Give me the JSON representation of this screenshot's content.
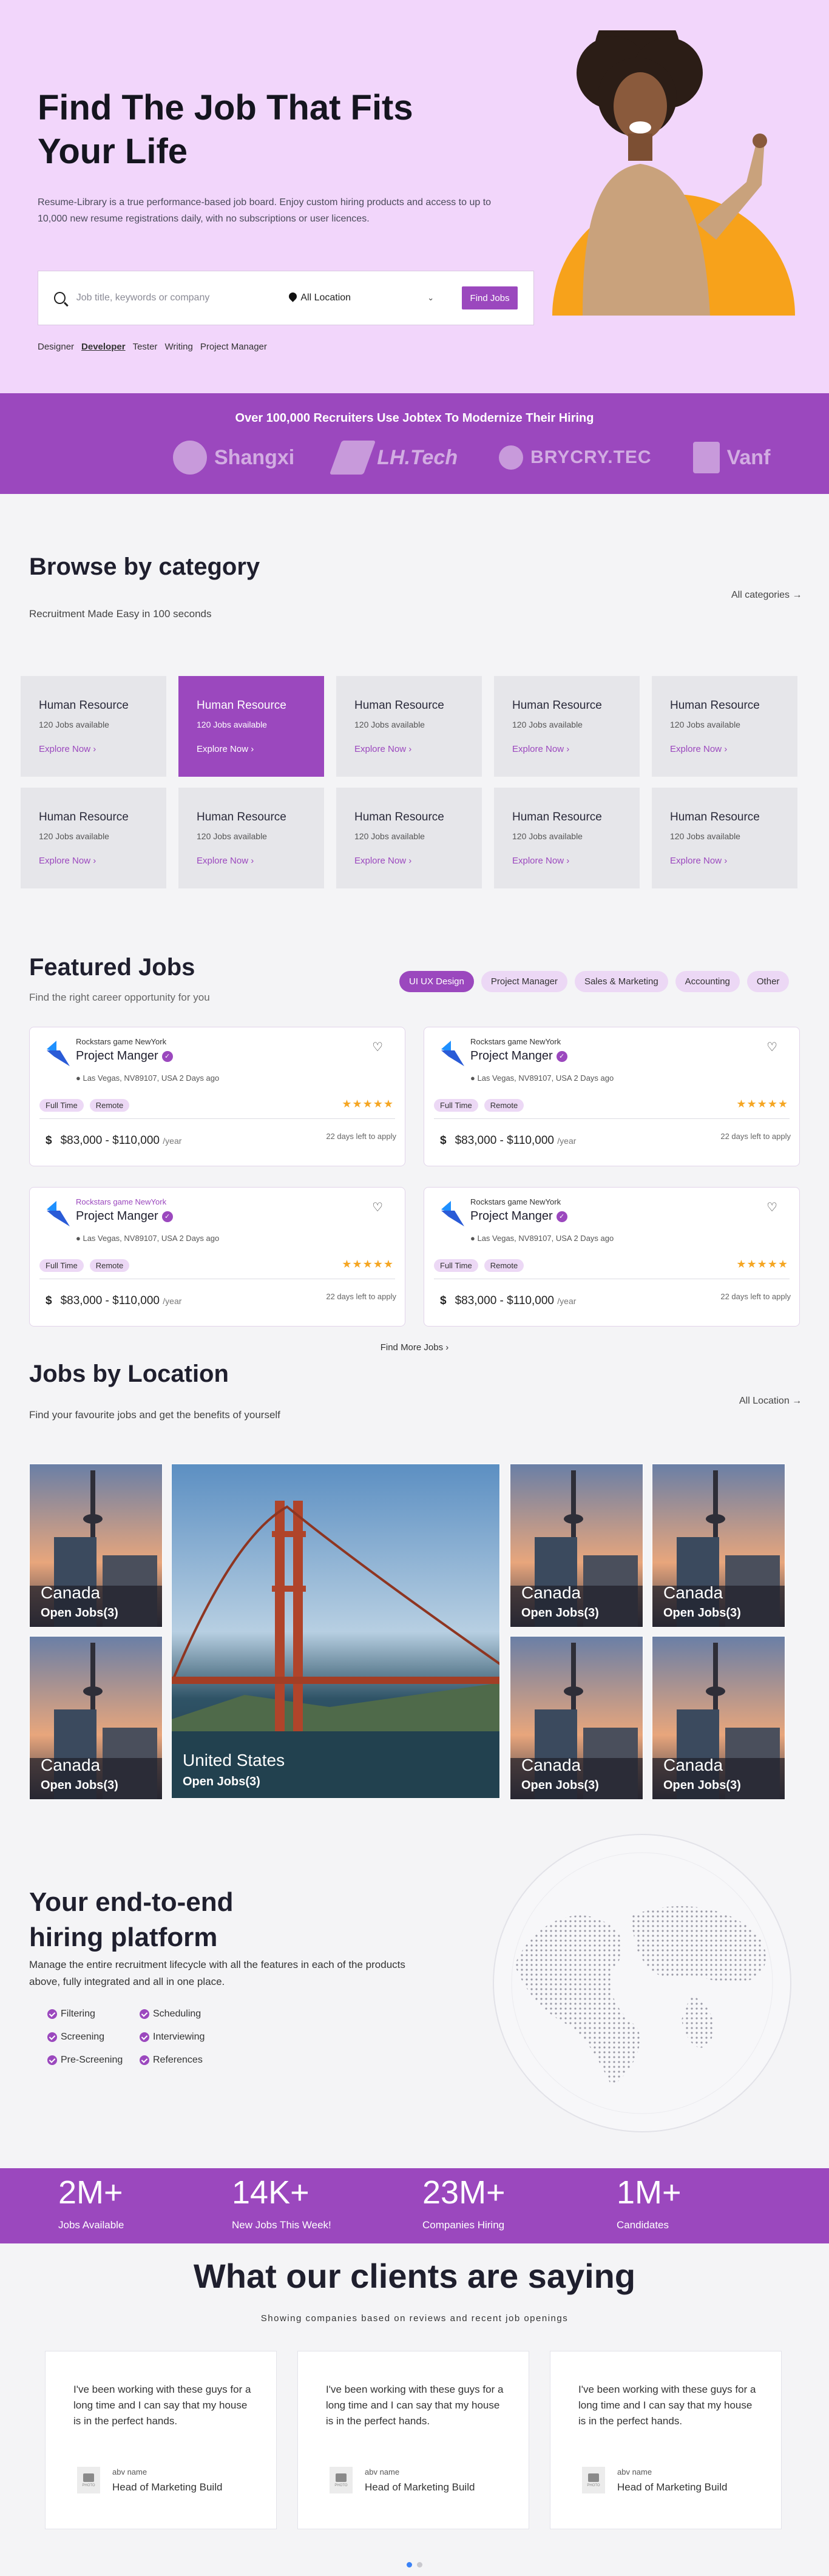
{
  "hero": {
    "title_line1": "Find The Job That Fits",
    "title_line2": "Your Life",
    "lead": "Resume-Library is a true performance-based job board. Enjoy custom hiring products and access to up to 10,000 new resume registrations daily, with no subscriptions or user licences.",
    "search_placeholder": "Job title, keywords or company",
    "location_value": "All Location",
    "find_button": "Find Jobs",
    "tags": [
      "Designer",
      "Developer",
      "Tester",
      "Writing",
      "Project Manager"
    ],
    "active_tag": "Developer"
  },
  "recruiters": {
    "heading": "Over 100,000 Recruiters Use Jobtex To Modernize Their Hiring",
    "logos": [
      "Shangxi",
      "LH.Tech",
      "BRYCRY.TEC",
      "Vanf"
    ]
  },
  "browse": {
    "title": "Browse by category",
    "subtitle": "Recruitment Made Easy in 100 seconds",
    "see_all": "All categories",
    "categories": [
      {
        "title": "Human Resource",
        "count": "120 Jobs available",
        "cta": "Explore Now"
      },
      {
        "title": "Human Resource",
        "count": "120 Jobs available",
        "cta": "Explore Now"
      },
      {
        "title": "Human Resource",
        "count": "120 Jobs available",
        "cta": "Explore Now"
      },
      {
        "title": "Human Resource",
        "count": "120 Jobs available",
        "cta": "Explore Now"
      },
      {
        "title": "Human Resource",
        "count": "120 Jobs available",
        "cta": "Explore Now"
      },
      {
        "title": "Human Resource",
        "count": "120 Jobs available",
        "cta": "Explore Now"
      },
      {
        "title": "Human Resource",
        "count": "120 Jobs available",
        "cta": "Explore Now"
      },
      {
        "title": "Human Resource",
        "count": "120 Jobs available",
        "cta": "Explore Now"
      },
      {
        "title": "Human Resource",
        "count": "120 Jobs available",
        "cta": "Explore Now"
      },
      {
        "title": "Human Resource",
        "count": "120 Jobs available",
        "cta": "Explore Now"
      }
    ]
  },
  "featured": {
    "title": "Featured Jobs",
    "subtitle": "Find the right career opportunity for you",
    "filters": [
      "UI UX Design",
      "Project Manager",
      "Sales & Marketing",
      "Accounting",
      "Other"
    ],
    "jobs": [
      {
        "company": "Rockstars game NewYork",
        "role": "Project Manger",
        "meta": "Las Vegas, NV89107, USA 2 Days ago",
        "badges": [
          "Full Time",
          "Remote"
        ],
        "stars": "★★★★★",
        "salary": "$83,000 - $110,000",
        "per": "/year",
        "deadline": "22 days left to apply"
      },
      {
        "company": "Rockstars game NewYork",
        "role": "Project Manger",
        "meta": "Las Vegas, NV89107, USA 2 Days ago",
        "badges": [
          "Full Time",
          "Remote"
        ],
        "stars": "★★★★★",
        "salary": "$83,000 - $110,000",
        "per": "/year",
        "deadline": "22 days left to apply"
      },
      {
        "company": "Rockstars game NewYork",
        "role": "Project Manger",
        "meta": "Las Vegas, NV89107, USA 2 Days ago",
        "badges": [
          "Full Time",
          "Remote"
        ],
        "stars": "★★★★★",
        "salary": "$83,000 - $110,000",
        "per": "/year",
        "deadline": "22 days left to apply"
      },
      {
        "company": "Rockstars game NewYork",
        "role": "Project Manger",
        "meta": "Las Vegas, NV89107, USA 2 Days ago",
        "badges": [
          "Full Time",
          "Remote"
        ],
        "stars": "★★★★★",
        "salary": "$83,000 - $110,000",
        "per": "/year",
        "deadline": "22 days left to apply"
      }
    ],
    "find_more": "Find More Jobs"
  },
  "locations": {
    "title": "Jobs by Location",
    "subtitle": "Find your favourite jobs and get the benefits of yourself",
    "see_all": "All Location",
    "tiles": [
      {
        "country": "Canada",
        "jobs": "Open Jobs(3)"
      },
      {
        "country": "United States",
        "jobs": "Open Jobs(3)"
      },
      {
        "country": "Canada",
        "jobs": "Open Jobs(3)"
      },
      {
        "country": "Canada",
        "jobs": "Open Jobs(3)"
      },
      {
        "country": "Canada",
        "jobs": "Open Jobs(3)"
      },
      {
        "country": "Canada",
        "jobs": "Open Jobs(3)"
      },
      {
        "country": "Canada",
        "jobs": "Open Jobs(3)"
      }
    ]
  },
  "platform": {
    "title_line1": "Your end-to-end",
    "title_line2": "hiring platform",
    "subtitle": "Manage the entire recruitment lifecycle with all the features in each of the products above, fully integrated and all in one place.",
    "features": [
      "Filtering",
      "Scheduling",
      "Screening",
      "Interviewing",
      "Pre-Screening",
      "References"
    ]
  },
  "stats": [
    {
      "value": "2M+",
      "label": "Jobs Available"
    },
    {
      "value": "14K+",
      "label": "New Jobs This Week!"
    },
    {
      "value": "23M+",
      "label": "Companies Hiring"
    },
    {
      "value": "1M+",
      "label": "Candidates"
    }
  ],
  "testimonials": {
    "title": "What our clients are saying",
    "subtitle": "Showing companies based on reviews and recent job openings",
    "items": [
      {
        "quote": "I've been working with these guys for a long time and I can say that my house is in the perfect hands.",
        "name": "abv name",
        "role": "Head of Marketing Build"
      },
      {
        "quote": "I've been working with these guys for a long time and I can say that my house is in the perfect hands.",
        "name": "abv name",
        "role": "Head of Marketing Build"
      },
      {
        "quote": "I've been working with these guys for a long time and I can say that my house is in the perfect hands.",
        "name": "abv name",
        "role": "Head of Marketing Build"
      }
    ],
    "photo_label": "PHOTO"
  },
  "colors": {
    "brand": "#9b48be",
    "hero_bg": "#f2d6fb",
    "star": "#f5a623",
    "accent_orange": "#f7a21b"
  }
}
